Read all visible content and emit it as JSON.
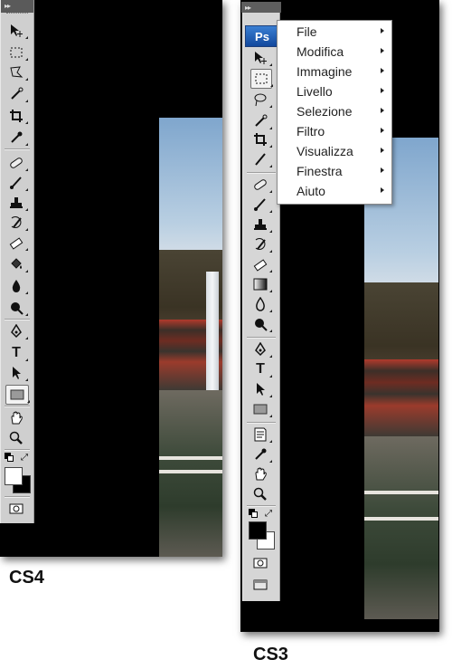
{
  "cs4": {
    "caption": "CS4",
    "grip": "▸▸"
  },
  "cs3": {
    "caption": "CS3",
    "grip": "▸▸",
    "logo": "Ps",
    "menu": [
      {
        "label": "File"
      },
      {
        "label": "Modifica"
      },
      {
        "label": "Immagine"
      },
      {
        "label": "Livello"
      },
      {
        "label": "Selezione"
      },
      {
        "label": "Filtro"
      },
      {
        "label": "Visualizza"
      },
      {
        "label": "Finestra"
      },
      {
        "label": "Aiuto"
      }
    ]
  },
  "icons": {
    "move": "move-icon",
    "marquee": "marquee-icon",
    "lasso": "lasso-icon",
    "wand": "magic-wand-icon",
    "crop": "crop-icon",
    "eyedropper": "eyedropper-icon",
    "heal": "healing-brush-icon",
    "brush": "brush-icon",
    "stamp": "clone-stamp-icon",
    "history": "history-brush-icon",
    "eraser": "eraser-icon",
    "bucket": "paint-bucket-icon",
    "blur": "blur-icon",
    "dodge": "dodge-icon",
    "pen": "pen-icon",
    "type": "type-icon",
    "select": "path-selection-icon",
    "shape": "rectangle-shape-icon",
    "hand": "hand-icon",
    "zoom": "zoom-icon",
    "quickmask": "quick-mask-icon",
    "screenmode": "screen-mode-icon",
    "notes": "notes-icon"
  },
  "colors": {
    "ps_logo": "#1a56b0",
    "toolbar": "#cfcfcf",
    "menu_bg": "#ffffff"
  },
  "text": {
    "type_tool": "T"
  }
}
